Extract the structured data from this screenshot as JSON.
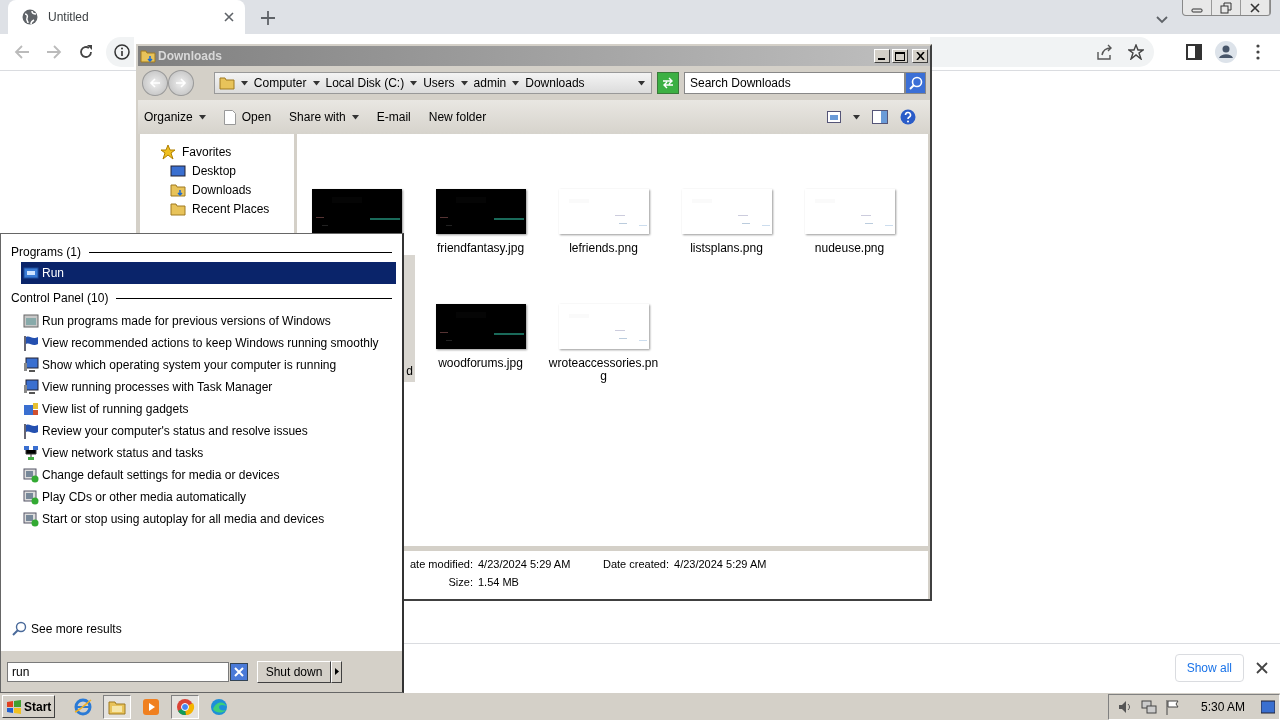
{
  "browser": {
    "tab": {
      "title": "Untitled",
      "selected": true
    },
    "download_bar": {
      "button": "Show all"
    }
  },
  "explorer": {
    "title": "Downloads",
    "breadcrumb": [
      "Computer",
      "Local Disk (C:)",
      "Users",
      "admin",
      "Downloads"
    ],
    "search": {
      "placeholder": "Search Downloads"
    },
    "toolbar": [
      {
        "label": "Organize",
        "kind": "dropdown"
      },
      {
        "label": "Open",
        "kind": "icon"
      },
      {
        "label": "Share with",
        "kind": "dropdown"
      },
      {
        "label": "E-mail",
        "kind": "plain"
      },
      {
        "label": "New folder",
        "kind": "plain"
      }
    ],
    "nav": [
      {
        "label": "Favorites",
        "kind": "favorites"
      },
      {
        "label": "Desktop",
        "kind": "desktop"
      },
      {
        "label": "Downloads",
        "kind": "downloads"
      },
      {
        "label": "Recent Places",
        "kind": "recent"
      }
    ],
    "files": [
      {
        "kind": "dark_picture",
        "selected": false
      },
      {
        "name": "friendfantasy.jpg",
        "kind": "dark_picture",
        "selected": false
      },
      {
        "name": "lefriends.png",
        "kind": "light_picture",
        "selected": false
      },
      {
        "name": "listsplans.png",
        "kind": "light_picture",
        "selected": false
      },
      {
        "name": "nudeuse.png",
        "kind": "light_picture",
        "selected": false
      },
      {
        "name": "d",
        "kind": "name_only",
        "selected": true
      },
      {
        "name": "woodforums.jpg",
        "kind": "dark_picture",
        "selected": false
      },
      {
        "name": "wroteaccessories.png",
        "kind": "light_picture",
        "selected": false
      }
    ],
    "details": [
      {
        "label": "ate modified:",
        "value": "4/23/2024 5:29 AM"
      },
      {
        "label": "Size:",
        "value": "1.54 MB"
      },
      {
        "label": "Date created:",
        "value": "4/23/2024 5:29 AM"
      }
    ]
  },
  "start_menu": {
    "groups": [
      {
        "title": "Programs (1)",
        "items": [
          {
            "label": "Run",
            "kind": "run",
            "selected": true
          }
        ]
      },
      {
        "title": "Control Panel (10)",
        "items": [
          {
            "label": "Run programs made for previous versions of Windows",
            "kind": "compat",
            "selected": false
          },
          {
            "label": "View recommended actions to keep Windows running smoothly",
            "kind": "flag",
            "selected": false
          },
          {
            "label": "Show which operating system your computer is running",
            "kind": "monitor",
            "selected": false
          },
          {
            "label": "View running processes with Task Manager",
            "kind": "monitor",
            "selected": false
          },
          {
            "label": "View list of running gadgets",
            "kind": "gadgets",
            "selected": false
          },
          {
            "label": "Review your computer's status and resolve issues",
            "kind": "flag",
            "selected": false
          },
          {
            "label": "View network status and tasks",
            "kind": "network",
            "selected": false
          },
          {
            "label": "Change default settings for media or devices",
            "kind": "media",
            "selected": false
          },
          {
            "label": "Play CDs or other media automatically",
            "kind": "media",
            "selected": false
          },
          {
            "label": "Start or stop using autoplay for all media and devices",
            "kind": "media",
            "selected": false
          }
        ]
      }
    ],
    "more": "See more results",
    "search": {
      "value": "run"
    },
    "shutdown": "Shut down"
  },
  "taskbar": {
    "start": "Start",
    "apps": [
      {
        "kind": "ie",
        "selected": false
      },
      {
        "kind": "folder",
        "selected": true
      },
      {
        "kind": "media",
        "selected": false
      },
      {
        "kind": "chrome",
        "selected": true
      },
      {
        "kind": "edge",
        "selected": false
      }
    ],
    "clock": "5:30 AM"
  }
}
